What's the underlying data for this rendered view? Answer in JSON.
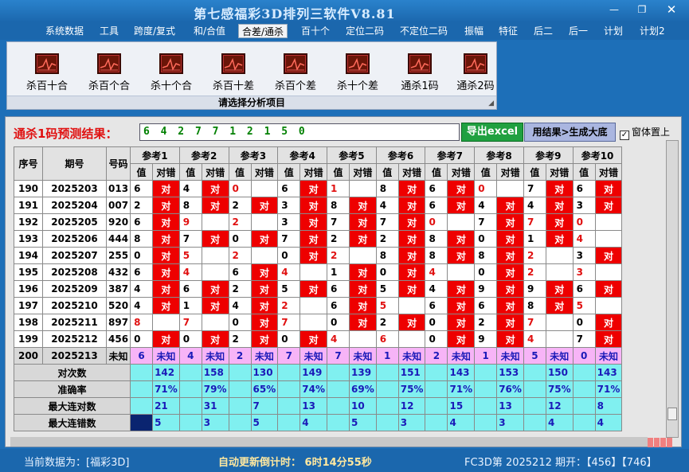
{
  "window": {
    "title": "第七感福彩3D排列三软件V8.81"
  },
  "menu": [
    "系统数据",
    "工具",
    "跨度/复式",
    "和/合值",
    "合差/通杀",
    "百十个",
    "定位二码",
    "不定位二码",
    "振幅",
    "特征",
    "后二",
    "后一",
    "计划",
    "计划2"
  ],
  "menu_active": 4,
  "ribbon": {
    "items": [
      "杀百十合",
      "杀百个合",
      "杀十个合",
      "杀百十差",
      "杀百个差",
      "杀十个差",
      "通杀1码",
      "通杀2码"
    ],
    "caption": "请选择分析项目"
  },
  "prediction": {
    "label": "通杀1码预测结果：",
    "value": "6 4 2 7 7 1 2 1 5 0",
    "export_label": "导出excel",
    "gen_label": "用结果>生成大底",
    "ontop_label": "窗体置上",
    "ontop_checked": "✓"
  },
  "table": {
    "h_seq": "序号",
    "h_issue": "期号",
    "h_code": "号码",
    "refs": [
      "参考1",
      "参考2",
      "参考3",
      "参考4",
      "参考5",
      "参考6",
      "参考7",
      "参考8",
      "参考9",
      "参考10"
    ],
    "h_val": "值",
    "h_res": "对错",
    "hit": "对",
    "unknown": "未知",
    "rows": [
      {
        "seq": "190",
        "issue": "2025203",
        "code": "013",
        "vals": [
          "6",
          "4",
          "0",
          "6",
          "1",
          "8",
          "6",
          "0",
          "7",
          "6"
        ],
        "hits": [
          1,
          1,
          0,
          1,
          0,
          1,
          1,
          0,
          1,
          1
        ],
        "miss": [
          0,
          0,
          1,
          0,
          1,
          0,
          0,
          1,
          0,
          0
        ]
      },
      {
        "seq": "191",
        "issue": "2025204",
        "code": "007",
        "vals": [
          "2",
          "8",
          "2",
          "3",
          "8",
          "4",
          "6",
          "4",
          "4",
          "3"
        ],
        "hits": [
          1,
          1,
          1,
          1,
          1,
          1,
          1,
          1,
          1,
          1
        ],
        "miss": [
          0,
          0,
          0,
          0,
          0,
          0,
          0,
          0,
          0,
          0
        ]
      },
      {
        "seq": "192",
        "issue": "2025205",
        "code": "920",
        "vals": [
          "6",
          "9",
          "2",
          "3",
          "7",
          "7",
          "0",
          "7",
          "7",
          "0"
        ],
        "hits": [
          1,
          0,
          0,
          1,
          1,
          1,
          0,
          1,
          1,
          0
        ],
        "miss": [
          0,
          1,
          1,
          0,
          0,
          0,
          1,
          0,
          1,
          1
        ]
      },
      {
        "seq": "193",
        "issue": "2025206",
        "code": "444",
        "vals": [
          "8",
          "7",
          "0",
          "7",
          "2",
          "2",
          "8",
          "0",
          "1",
          "4"
        ],
        "hits": [
          1,
          1,
          1,
          1,
          1,
          1,
          1,
          1,
          1,
          0
        ],
        "miss": [
          0,
          0,
          0,
          0,
          0,
          0,
          0,
          0,
          0,
          1
        ]
      },
      {
        "seq": "194",
        "issue": "2025207",
        "code": "255",
        "vals": [
          "0",
          "5",
          "2",
          "0",
          "2",
          "8",
          "8",
          "8",
          "2",
          "3"
        ],
        "hits": [
          1,
          0,
          0,
          1,
          0,
          1,
          1,
          1,
          0,
          1
        ],
        "miss": [
          0,
          1,
          1,
          0,
          1,
          0,
          0,
          0,
          1,
          0
        ]
      },
      {
        "seq": "195",
        "issue": "2025208",
        "code": "432",
        "vals": [
          "6",
          "4",
          "6",
          "4",
          "1",
          "0",
          "4",
          "0",
          "2",
          "3"
        ],
        "hits": [
          1,
          0,
          1,
          0,
          1,
          1,
          0,
          1,
          0,
          0
        ],
        "miss": [
          0,
          1,
          0,
          1,
          0,
          0,
          1,
          0,
          1,
          1
        ]
      },
      {
        "seq": "196",
        "issue": "2025209",
        "code": "387",
        "vals": [
          "4",
          "6",
          "2",
          "5",
          "6",
          "5",
          "4",
          "9",
          "9",
          "6"
        ],
        "hits": [
          1,
          1,
          1,
          1,
          1,
          1,
          1,
          1,
          1,
          1
        ],
        "miss": [
          0,
          0,
          0,
          0,
          0,
          0,
          0,
          0,
          0,
          0
        ]
      },
      {
        "seq": "197",
        "issue": "2025210",
        "code": "520",
        "vals": [
          "4",
          "1",
          "4",
          "2",
          "6",
          "5",
          "6",
          "6",
          "8",
          "5"
        ],
        "hits": [
          1,
          1,
          1,
          0,
          1,
          0,
          1,
          1,
          1,
          0
        ],
        "miss": [
          0,
          0,
          0,
          1,
          0,
          1,
          0,
          0,
          0,
          1
        ]
      },
      {
        "seq": "198",
        "issue": "2025211",
        "code": "897",
        "vals": [
          "8",
          "7",
          "0",
          "7",
          "0",
          "2",
          "0",
          "2",
          "7",
          "0"
        ],
        "hits": [
          0,
          0,
          1,
          0,
          1,
          1,
          1,
          1,
          0,
          1
        ],
        "miss": [
          1,
          1,
          0,
          1,
          0,
          0,
          0,
          0,
          1,
          0
        ]
      },
      {
        "seq": "199",
        "issue": "2025212",
        "code": "456",
        "vals": [
          "0",
          "0",
          "2",
          "0",
          "4",
          "6",
          "0",
          "9",
          "4",
          "7"
        ],
        "hits": [
          1,
          1,
          1,
          1,
          0,
          0,
          1,
          1,
          0,
          1
        ],
        "miss": [
          0,
          0,
          0,
          0,
          1,
          1,
          0,
          0,
          1,
          0
        ]
      }
    ],
    "pred_row": {
      "seq": "200",
      "issue": "2025213",
      "code": "未知",
      "vals": [
        "6",
        "4",
        "2",
        "7",
        "7",
        "1",
        "2",
        "1",
        "5",
        "0"
      ]
    },
    "stats": [
      {
        "label": "对次数",
        "values": [
          "142",
          "158",
          "130",
          "149",
          "139",
          "151",
          "143",
          "153",
          "150",
          "143"
        ]
      },
      {
        "label": "准确率",
        "values": [
          "71%",
          "79%",
          "65%",
          "74%",
          "69%",
          "75%",
          "71%",
          "76%",
          "75%",
          "71%"
        ]
      },
      {
        "label": "最大连对数",
        "values": [
          "21",
          "31",
          "7",
          "13",
          "10",
          "12",
          "15",
          "13",
          "12",
          "8"
        ]
      },
      {
        "label": "最大连错数",
        "values": [
          "5",
          "3",
          "5",
          "4",
          "5",
          "3",
          "4",
          "3",
          "4",
          "4"
        ]
      }
    ]
  },
  "status": {
    "current": "当前数据为：[福彩3D]",
    "countdown": "自动更新倒计时： 6时14分55秒",
    "latest": "FC3D第 2025212 期开：【456】【746】"
  },
  "colors": {
    "hit": "#ee0000",
    "stats_bg": "#80f0f0",
    "pred_bg": "#f7b4f7",
    "window_bg": "#1d6fb8"
  }
}
